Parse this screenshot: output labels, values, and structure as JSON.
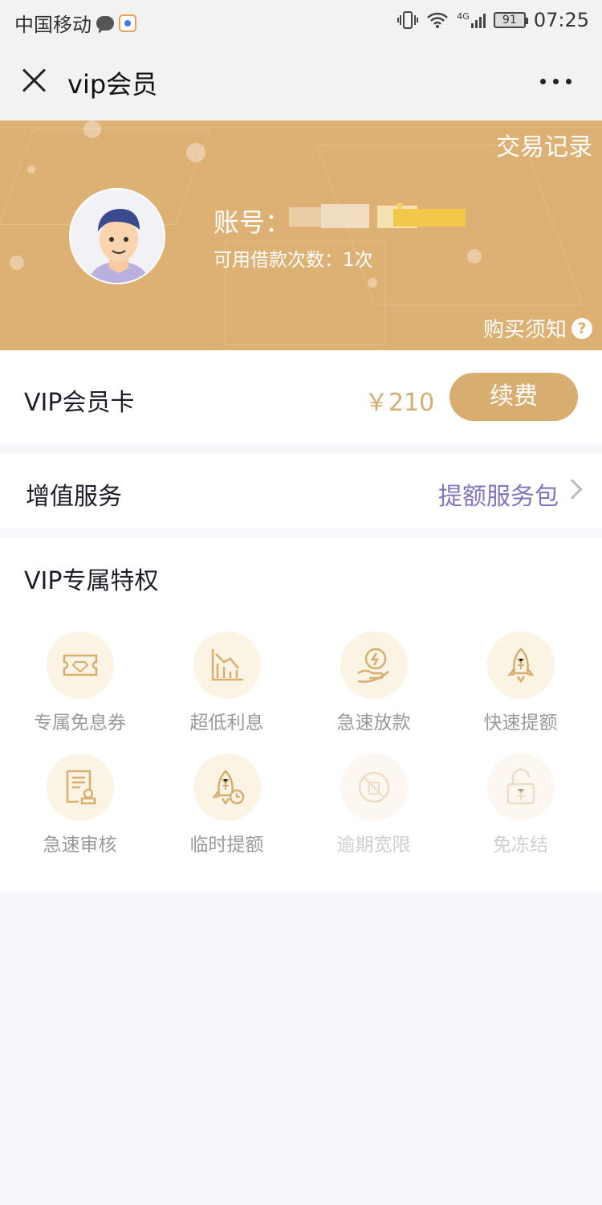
{
  "status_bar": {
    "carrier": "中国移动",
    "network": "4G",
    "battery": "91",
    "time": "07:25"
  },
  "nav": {
    "title": "vip会员",
    "close_icon": "close-icon",
    "more_icon": "more-icon"
  },
  "banner": {
    "transaction_record": "交易记录",
    "account_label": "账号：",
    "loan_count": "可用借款次数：1次",
    "purchase_notice": "购买须知",
    "background_color": "#ddb073"
  },
  "vip_card": {
    "label": "VIP会员卡",
    "price": "￥210",
    "renew_button": "续费",
    "accent_color": "#d8ad70"
  },
  "value_added": {
    "label": "增值服务",
    "link": "提额服务包",
    "link_color": "#8474c0"
  },
  "privileges": {
    "title": "VIP专属特权",
    "items": [
      {
        "label": "专属免息券",
        "icon": "ticket-diamond-icon",
        "enabled": true
      },
      {
        "label": "超低利息",
        "icon": "chart-down-icon",
        "enabled": true
      },
      {
        "label": "急速放款",
        "icon": "coin-hand-icon",
        "enabled": true
      },
      {
        "label": "快速提额",
        "icon": "rocket-yen-icon",
        "enabled": true
      },
      {
        "label": "急速审核",
        "icon": "document-review-icon",
        "enabled": true
      },
      {
        "label": "临时提额",
        "icon": "rocket-clock-icon",
        "enabled": true
      },
      {
        "label": "逾期宽限",
        "icon": "overdue-icon",
        "enabled": false
      },
      {
        "label": "免冻结",
        "icon": "unlock-yen-icon",
        "enabled": false
      }
    ]
  }
}
